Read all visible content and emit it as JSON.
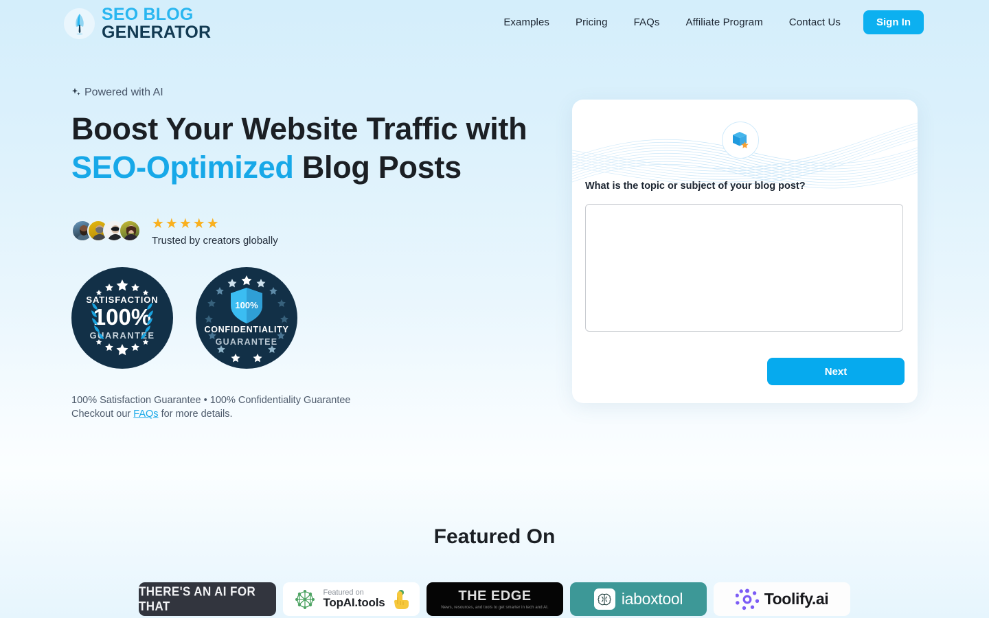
{
  "brand": {
    "logo_line1": "SEO BLOG",
    "logo_line2": "GENERATOR",
    "logo_icon": "quill-feather-icon",
    "accent_color": "#29b6f0",
    "dark_color": "#123a52"
  },
  "nav": {
    "items": [
      {
        "label": "Examples"
      },
      {
        "label": "Pricing"
      },
      {
        "label": "FAQs"
      },
      {
        "label": "Affiliate Program"
      },
      {
        "label": "Contact Us"
      }
    ],
    "signin_label": "Sign In",
    "signin_color": "#0cb0f0"
  },
  "hero": {
    "eyebrow": "Powered with AI",
    "eyebrow_icon": "sparkle-icon",
    "headline_line1": "Boost Your Website Traffic with",
    "headline_accent": "SEO-Optimized",
    "headline_tail": " Blog Posts",
    "headline_accent_color": "#17a8e8",
    "stars": "★★★★★",
    "star_color": "#f9b01e",
    "star_count": 5,
    "trusted_text": "Trusted by creators globally",
    "avatar_count": 4
  },
  "badges": [
    {
      "name": "satisfaction-guarantee-badge",
      "title": "SATISFACTION",
      "percent": "100%",
      "subtitle": "GUARANTEE",
      "bg_color": "#123047"
    },
    {
      "name": "confidentiality-guarantee-badge",
      "shield_percent": "100%",
      "title": "CONFIDENTIALITY",
      "subtitle": "GUARANTEE",
      "bg_color": "#123047"
    }
  ],
  "guarantee": {
    "line1": "100% Satisfaction Guarantee • 100% Confidentiality Guarantee",
    "line2_before": "Checkout our ",
    "link_label": "FAQs",
    "line2_after": " for more details."
  },
  "card": {
    "icon": "box-star-icon",
    "question_label": "What is the topic or subject of your blog post?",
    "textarea_value": "",
    "textarea_placeholder": "",
    "next_label": "Next",
    "next_color": "#06aaee"
  },
  "featured": {
    "title": "Featured On",
    "brands": [
      {
        "name": "theres-an-ai-for-that",
        "text": "THERE'S AN AI FOR THAT"
      },
      {
        "name": "topai-tools",
        "pre_text": "Featured on",
        "text": "TopAI.tools",
        "icon": "network-graph-icon"
      },
      {
        "name": "the-edge",
        "text": "THE EDGE",
        "tagline": "News, resources, and tools to get smarter in tech and AI."
      },
      {
        "name": "iaboxtool",
        "text": "iaboxtool",
        "icon": "brain-icon"
      },
      {
        "name": "toolify-ai",
        "text": "Toolify.ai",
        "icon": "purple-ring-icon"
      }
    ]
  }
}
